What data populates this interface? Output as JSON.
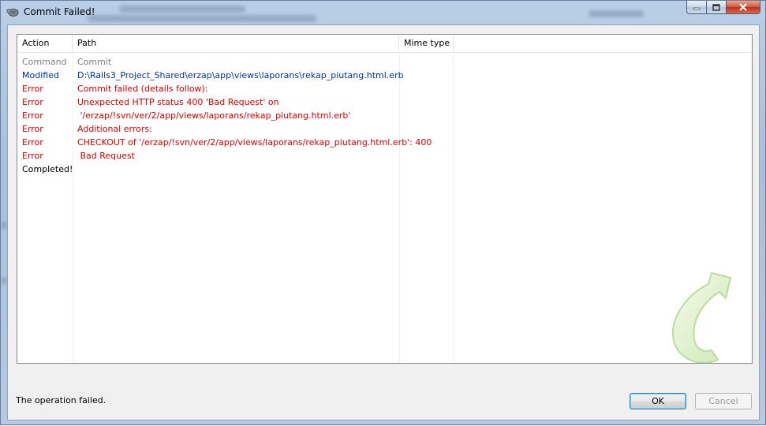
{
  "window": {
    "title": "Commit Failed!"
  },
  "columns": [
    "Action",
    "Path",
    "Mime type"
  ],
  "rows": [
    {
      "action": "Command",
      "path": "Commit",
      "color": "gray"
    },
    {
      "action": "Modified",
      "path": "D:\\Rails3_Project_Shared\\erzap\\app\\views\\laporans\\rekap_piutang.html.erb",
      "color": "blue"
    },
    {
      "action": "Error",
      "path": "Commit failed (details follow):",
      "color": "red"
    },
    {
      "action": "Error",
      "path": "Unexpected HTTP status 400 'Bad Request' on",
      "color": "red"
    },
    {
      "action": "Error",
      "path": " '/erzap/!svn/ver/2/app/views/laporans/rekap_piutang.html.erb'",
      "color": "red"
    },
    {
      "action": "Error",
      "path": "Additional errors:",
      "color": "red"
    },
    {
      "action": "Error",
      "path": "CHECKOUT of '/erzap/!svn/ver/2/app/views/laporans/rekap_piutang.html.erb': 400",
      "color": "red"
    },
    {
      "action": "Error",
      "path": " Bad Request",
      "color": "red"
    },
    {
      "action": "Completed!",
      "path": "",
      "color": "black"
    }
  ],
  "status_text": "The operation failed.",
  "buttons": {
    "ok": "OK",
    "cancel": "Cancel"
  },
  "colors": {
    "error": "#e00000",
    "modified": "#0033a0",
    "command": "#808080"
  },
  "icons": [
    "tortoisesvn-icon",
    "minimize-icon",
    "maximize-icon",
    "close-icon",
    "update-arrow-icon"
  ]
}
